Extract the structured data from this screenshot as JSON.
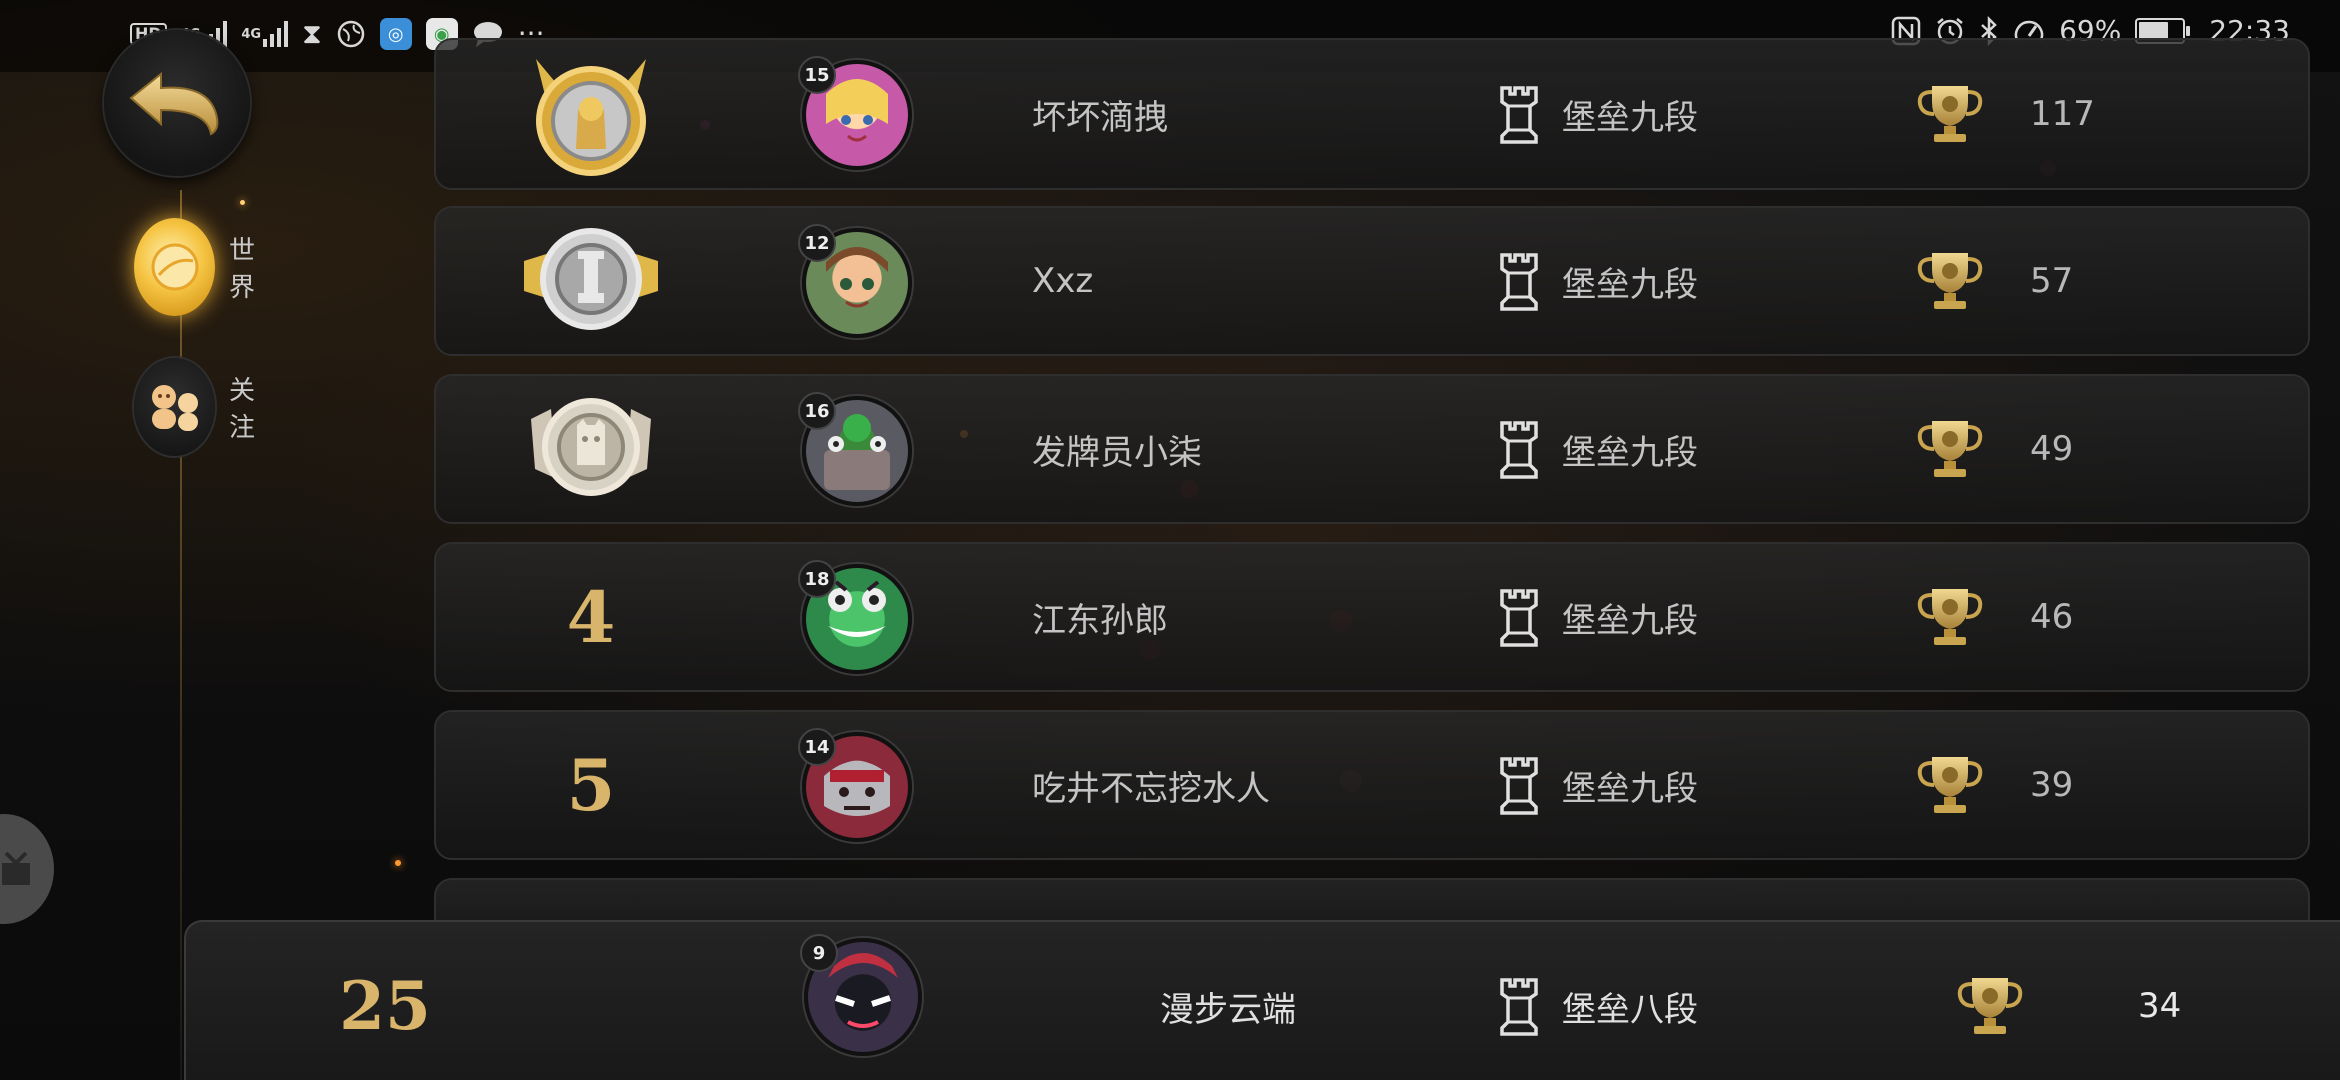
{
  "status_bar": {
    "hd": "HD",
    "net1": "4G",
    "net2": "4G",
    "battery_percent": "69%",
    "time": "22:33",
    "battery_level": 0.69,
    "left_icons": [
      "hd-icon",
      "signal-icon",
      "signal-icon",
      "hourglass-icon",
      "globe-icon",
      "app-icon",
      "app-icon",
      "chat-bubble-icon",
      "more-icon"
    ],
    "right_icons": [
      "nfc-icon",
      "alarm-icon",
      "bluetooth-icon",
      "speedometer-icon",
      "battery-icon"
    ]
  },
  "nav": {
    "world_label": "世界",
    "follow_label": "关注"
  },
  "rows": [
    {
      "rank": "",
      "rank_type": "gold-medal",
      "level": "15",
      "name": "坏坏滴拽",
      "tier": "堡垒九段",
      "trophies": "117",
      "avatar_color": "#c75aa8"
    },
    {
      "rank": "",
      "rank_type": "silver-medal",
      "level": "12",
      "name": "Xxz",
      "tier": "堡垒九段",
      "trophies": "57",
      "avatar_color": "#6a8a5a"
    },
    {
      "rank": "",
      "rank_type": "bronze-medal",
      "level": "16",
      "name": "发牌员小柒",
      "tier": "堡垒九段",
      "trophies": "49",
      "avatar_color": "#5a5a62"
    },
    {
      "rank": "4",
      "rank_type": "number",
      "level": "18",
      "name": "江东孙郎",
      "tier": "堡垒九段",
      "trophies": "46",
      "avatar_color": "#2e8a4a"
    },
    {
      "rank": "5",
      "rank_type": "number",
      "level": "14",
      "name": "吃井不忘挖水人",
      "tier": "堡垒九段",
      "trophies": "39",
      "avatar_color": "#8a2a3a"
    }
  ],
  "my_row": {
    "rank": "25",
    "level": "9",
    "name": "漫步云端",
    "tier": "堡垒八段",
    "trophies": "34",
    "avatar_color": "#3a3048"
  },
  "colors": {
    "accent_gold": "#d9b56c",
    "text_gray": "#c4c4c4"
  }
}
